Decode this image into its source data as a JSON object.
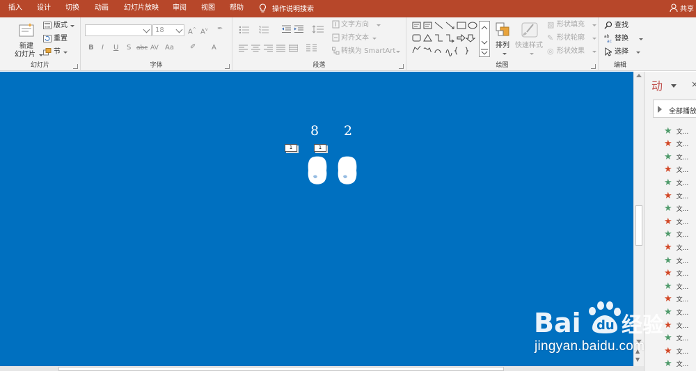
{
  "tabs": [
    "插入",
    "设计",
    "切换",
    "动画",
    "幻灯片放映",
    "审阅",
    "视图",
    "帮助"
  ],
  "tell_me": "操作说明搜索",
  "share": "共享",
  "ribbon": {
    "slides": {
      "label": "幻灯片",
      "new_slide_line1": "新建",
      "new_slide_line2": "幻灯片",
      "layout": "版式",
      "reset": "重置",
      "section": "节"
    },
    "font": {
      "label": "字体",
      "font_size": "18"
    },
    "paragraph": {
      "label": "段落",
      "text_direction": "文字方向",
      "align_text": "对齐文本",
      "convert_smartart": "转换为 SmartArt"
    },
    "drawing": {
      "label": "绘图",
      "arrange": "排列",
      "quick_styles": "快速样式",
      "shape_fill": "形状填充",
      "shape_outline": "形状轮廓",
      "shape_effects": "形状效果"
    },
    "editing": {
      "label": "编辑",
      "find": "查找",
      "replace": "替换",
      "select": "选择"
    }
  },
  "slide": {
    "background": "#0070c0",
    "numbers": [
      "8",
      "2"
    ],
    "tags": [
      "1",
      "1"
    ]
  },
  "animation_pane": {
    "title": "动",
    "play_all": "全部播放",
    "items": [
      {
        "label": "文...",
        "color": "green"
      },
      {
        "label": "文...",
        "color": "red"
      },
      {
        "label": "文...",
        "color": "green"
      },
      {
        "label": "文...",
        "color": "red"
      },
      {
        "label": "文...",
        "color": "green"
      },
      {
        "label": "文...",
        "color": "red"
      },
      {
        "label": "文...",
        "color": "green"
      },
      {
        "label": "文...",
        "color": "red"
      },
      {
        "label": "文...",
        "color": "green"
      },
      {
        "label": "文...",
        "color": "red"
      },
      {
        "label": "文...",
        "color": "green"
      },
      {
        "label": "文...",
        "color": "red"
      },
      {
        "label": "文...",
        "color": "green"
      },
      {
        "label": "文...",
        "color": "red"
      },
      {
        "label": "文...",
        "color": "green"
      },
      {
        "label": "文...",
        "color": "red"
      },
      {
        "label": "文...",
        "color": "green"
      },
      {
        "label": "文...",
        "color": "red"
      },
      {
        "label": "文...",
        "color": "green"
      }
    ]
  },
  "watermark": {
    "logo": "Bai du 经验",
    "url": "jingyan.baidu.com"
  },
  "colors": {
    "tab_bar": "#b7472a",
    "star_green": "#4e9a6a",
    "star_red": "#d24726"
  }
}
